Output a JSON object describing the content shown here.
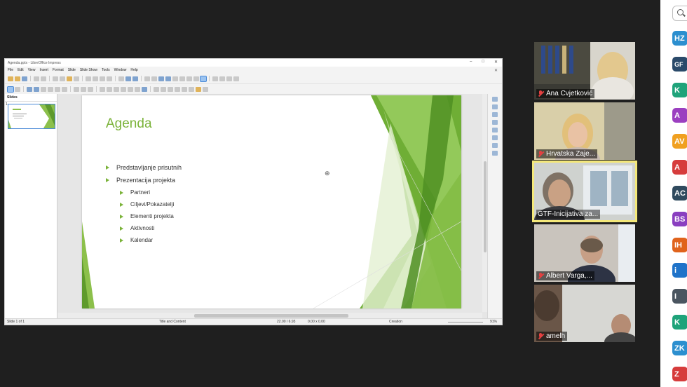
{
  "lo": {
    "title": "Agenda.pptx - LibreOffice Impress",
    "menu": [
      "File",
      "Edit",
      "View",
      "Insert",
      "Format",
      "Slide",
      "Slide Show",
      "Tools",
      "Window",
      "Help"
    ],
    "slides_pane_title": "Slides",
    "thumb_number": "1",
    "status": {
      "slide": "Slide 1 of 1",
      "layout": "Title and Content",
      "position": "22.00 / 6.93",
      "size": "0.00 x 0.00",
      "master": "Creation",
      "zoom": "91%"
    }
  },
  "slide": {
    "title": "Agenda",
    "bullets": [
      "Predstavljanje prisutnih",
      "Prezentacija projekta"
    ],
    "subbullets": [
      "Partneri",
      "Ciljevi/Pokazatelji",
      "Elementi projekta",
      "Aktivnosti",
      "Kalendar"
    ]
  },
  "tiles": [
    {
      "name": "Ana Cvjetković"
    },
    {
      "name": "Hrvatska Zaje..."
    },
    {
      "name": "GTF-Inicijativa za..."
    },
    {
      "name": "Albert Varga,..."
    },
    {
      "name": "amelh"
    }
  ],
  "participants": [
    {
      "initials": "HZ",
      "color": "#2c8fcf"
    },
    {
      "initials": "GF",
      "color": "#2a4a6a"
    },
    {
      "initials": "K",
      "color": "#1fa37a"
    },
    {
      "initials": "A",
      "color": "#9b3fc0"
    },
    {
      "initials": "AV",
      "color": "#f0a020"
    },
    {
      "initials": "A",
      "color": "#d63c3c"
    },
    {
      "initials": "AC",
      "color": "#2f4a5e"
    },
    {
      "initials": "BS",
      "color": "#8a3fc0"
    },
    {
      "initials": "IH",
      "color": "#e0631c"
    },
    {
      "initials": "i",
      "color": "#1f73c9"
    },
    {
      "initials": "I",
      "color": "#4a5560"
    },
    {
      "initials": "K",
      "color": "#1fa37a"
    },
    {
      "initials": "ZK",
      "color": "#2c8fcf"
    },
    {
      "initials": "Z",
      "color": "#d63c3c"
    }
  ]
}
